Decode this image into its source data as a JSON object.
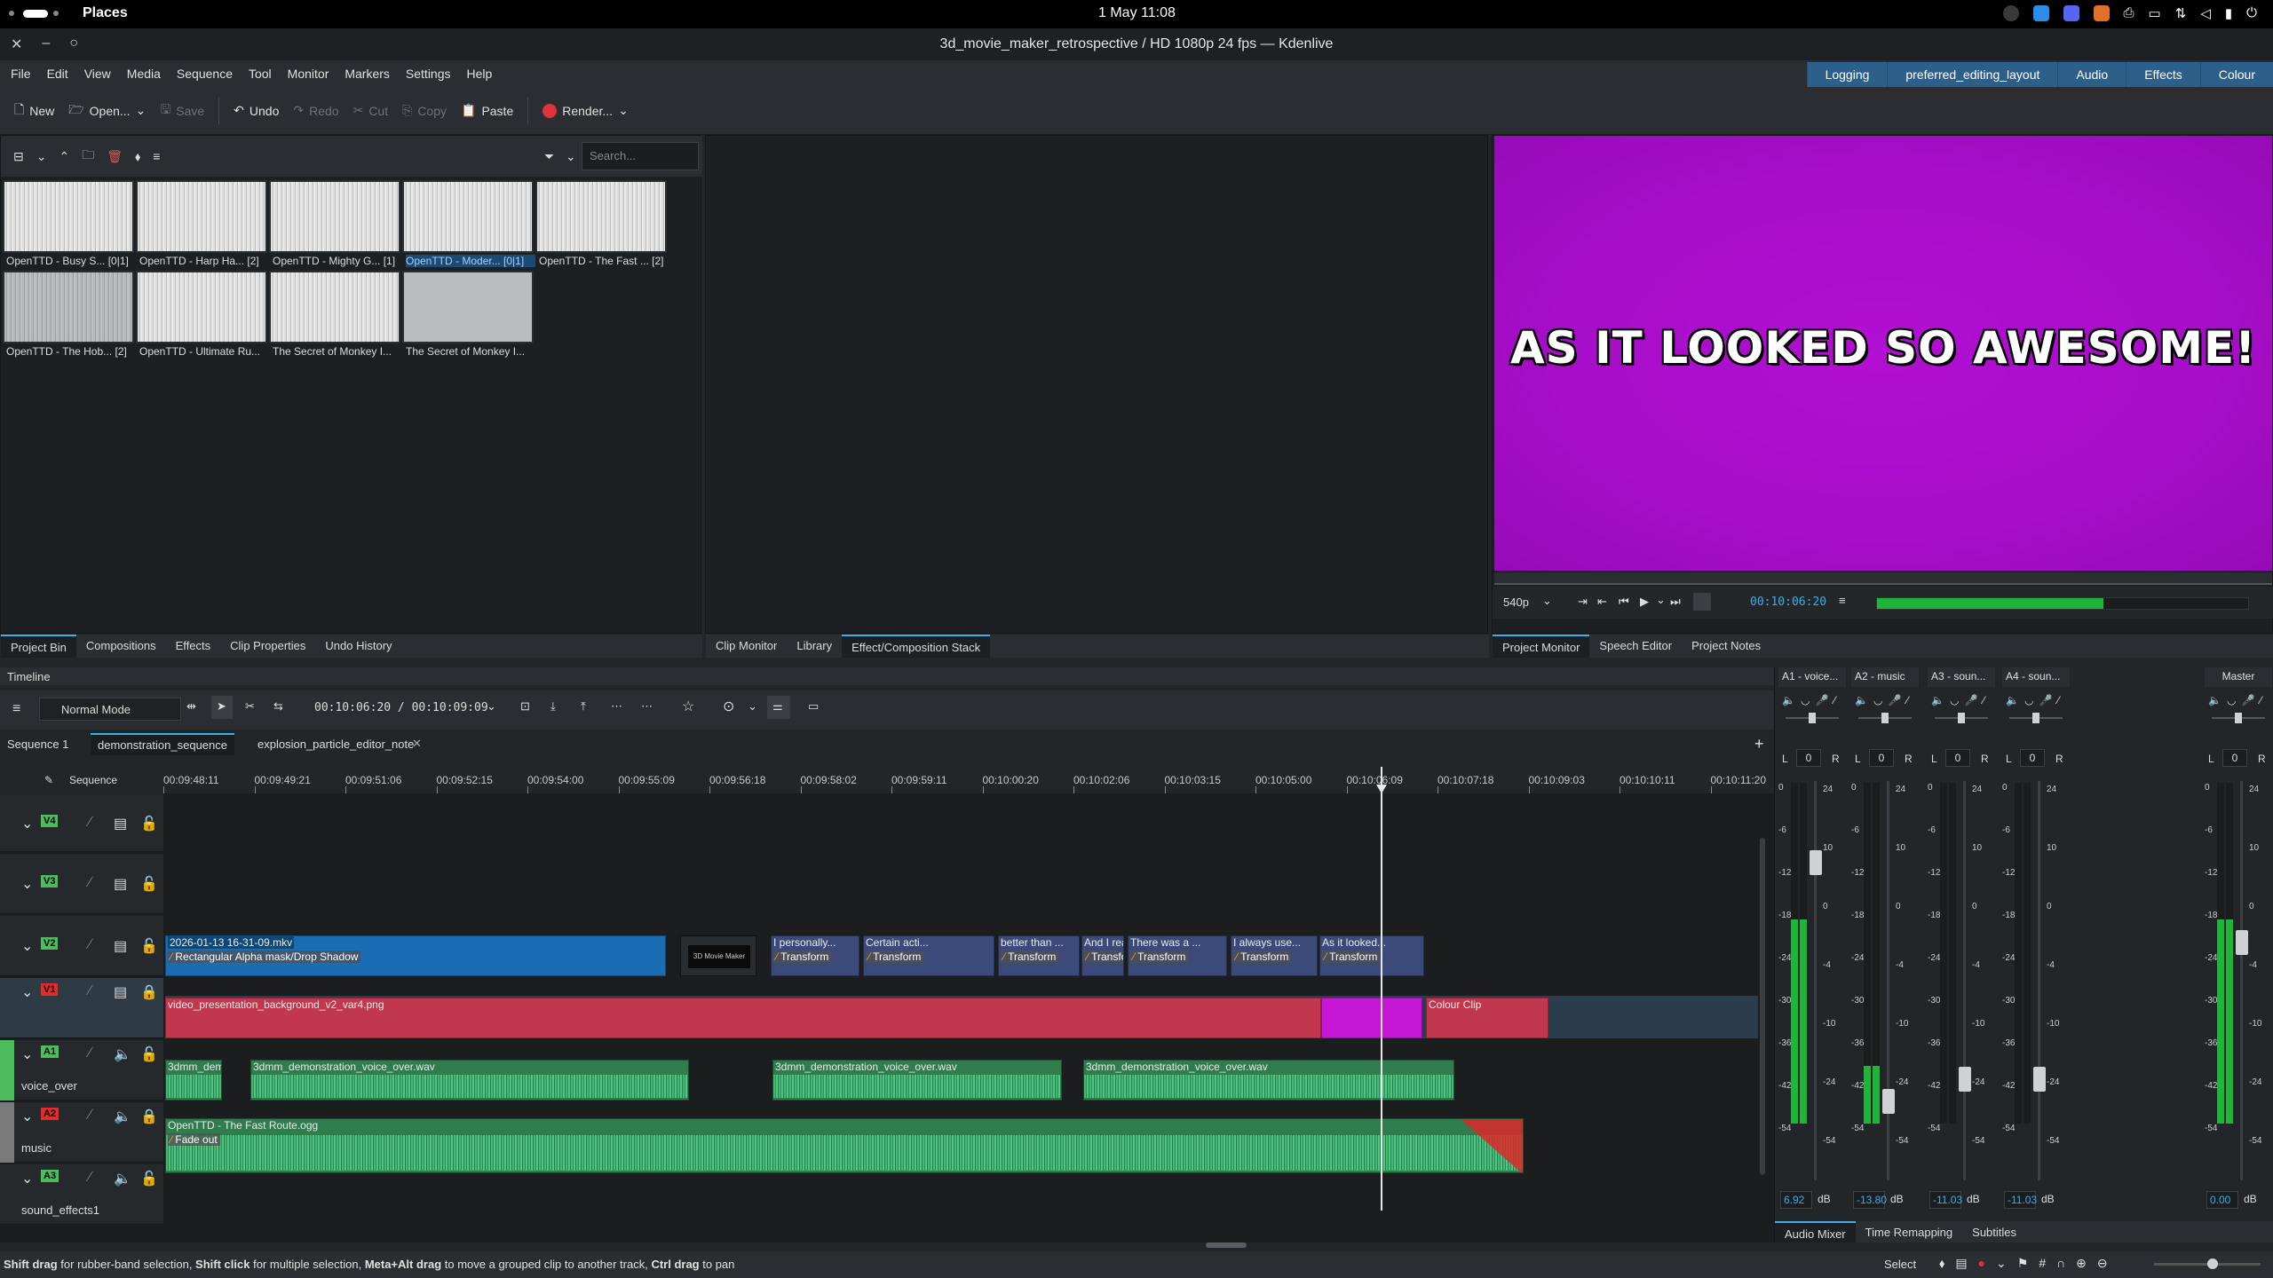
{
  "system_bar": {
    "places": "Places",
    "clock": "1 May  11:08"
  },
  "window": {
    "title": "3d_movie_maker_retrospective / HD 1080p 24 fps — Kdenlive"
  },
  "menu": [
    "File",
    "Edit",
    "View",
    "Media",
    "Sequence",
    "Tool",
    "Monitor",
    "Markers",
    "Settings",
    "Help"
  ],
  "layouts": [
    "Logging",
    "preferred_editing_layout",
    "Audio",
    "Effects",
    "Colour"
  ],
  "toolbar": {
    "new": "New",
    "open": "Open...",
    "save": "Save",
    "undo": "Undo",
    "redo": "Redo",
    "cut": "Cut",
    "copy": "Copy",
    "paste": "Paste",
    "render": "Render..."
  },
  "bin": {
    "search_placeholder": "Search...",
    "clips": [
      "OpenTTD - Busy S... [0|1]",
      "OpenTTD - Harp Ha... [2]",
      "OpenTTD - Mighty G... [1]",
      "OpenTTD - Moder... [0|1]",
      "OpenTTD - The Fast ... [2]",
      "OpenTTD - The Hob... [2]",
      "OpenTTD - Ultimate Ru...",
      "The Secret of Monkey I...",
      "The Secret of Monkey I..."
    ],
    "tabs": [
      "Project Bin",
      "Compositions",
      "Effects",
      "Clip Properties",
      "Undo History"
    ]
  },
  "clip_monitor": {
    "tabs": [
      "Clip Monitor",
      "Library",
      "Effect/Composition Stack"
    ]
  },
  "project_monitor": {
    "overlay_text": "AS IT LOOKED SO AWESOME!",
    "zoom": "540p",
    "timecode": "00:10:06:20",
    "level_fraction": 0.61,
    "tabs": [
      "Project Monitor",
      "Speech Editor",
      "Project Notes"
    ]
  },
  "timeline": {
    "title": "Timeline",
    "mode": "Normal Mode",
    "position": "00:10:06:20 / 00:10:09:09",
    "sequence_tabs": [
      "Sequence 1",
      "demonstration_sequence",
      "explosion_particle_editor_note"
    ],
    "sequence_label": "Sequence",
    "ruler": [
      "00:09:48:11",
      "00:09:49:21",
      "00:09:51:06",
      "00:09:52:15",
      "00:09:54:00",
      "00:09:55:09",
      "00:09:56:18",
      "00:09:58:02",
      "00:09:59:11",
      "00:10:00:20",
      "00:10:02:06",
      "00:10:03:15",
      "00:10:05:00",
      "00:10:06:09",
      "00:10:07:18",
      "00:10:09:03",
      "00:10:10:11",
      "00:10:11:20"
    ],
    "tracks": {
      "v4": "V4",
      "v3": "V3",
      "v2": "V2",
      "v1": "V1",
      "a1": "A1",
      "a1_name": "voice_over",
      "a2": "A2",
      "a2_name": "music",
      "a3": "A3",
      "a3_name": "sound_effects1"
    },
    "clips": {
      "v2_main": "2026-01-13 16-31-09.mkv",
      "v2_main_effect": "Rectangular Alpha mask/Drop Shadow",
      "v2_thumb_text": "3D Movie Maker",
      "v2_titles": [
        "I personally...",
        "Certain acti...",
        "better than ...",
        "And I rea",
        "There was a ...",
        "I always use...",
        "As it looked..."
      ],
      "v2_title_effect": "Transform",
      "v1_main": "video_presentation_background_v2_var4.png",
      "v1_colour": "Colour Clip",
      "a1_c1": "3dmm_dem",
      "a1_c2": "3dmm_demonstration_voice_over.wav",
      "a1_c3": "3dmm_demonstration_voice_over.wav",
      "a1_c4": "3dmm_demonstration_voice_over.wav",
      "a2_c1": "OpenTTD - The Fast Route.ogg",
      "a2_effect": "Fade out"
    }
  },
  "mixer": {
    "channels": [
      {
        "name": "A1 - voice...",
        "db": "6.92",
        "level_fraction": 0.6
      },
      {
        "name": "A2 - music",
        "db": "-13.80",
        "level_fraction": 0.17
      },
      {
        "name": "A3 - soun...",
        "db": "-11.03",
        "level_fraction": 0
      },
      {
        "name": "A4 - soun...",
        "db": "-11.03",
        "level_fraction": 0
      },
      {
        "name": "Master",
        "db": "0.00",
        "level_fraction": 0.6
      }
    ],
    "pan": "0",
    "unit": "dB",
    "scale": [
      "24",
      "10",
      "0",
      "-4",
      "-10",
      "-24",
      "-54"
    ],
    "scale_left": [
      "0",
      "-6",
      "-12",
      "-18",
      "-24",
      "-30",
      "-36",
      "-42",
      "-54"
    ],
    "tabs": [
      "Audio Mixer",
      "Time Remapping",
      "Subtitles"
    ]
  },
  "status": {
    "hint_b1": "Shift drag",
    "hint_t1": " for rubber-band selection, ",
    "hint_b2": "Shift click",
    "hint_t2": " for multiple selection, ",
    "hint_b3": "Meta+Alt drag",
    "hint_t3": " to move a grouped clip to another track, ",
    "hint_b4": "Ctrl drag",
    "hint_t4": " to pan",
    "select": "Select"
  },
  "colors": {
    "accent": "#3daee9",
    "v2_clip": "#1a6db3",
    "v1_clip": "#c1374e",
    "audio_clip": "#2f7d4d",
    "preview_bg": "#a60ec8"
  }
}
